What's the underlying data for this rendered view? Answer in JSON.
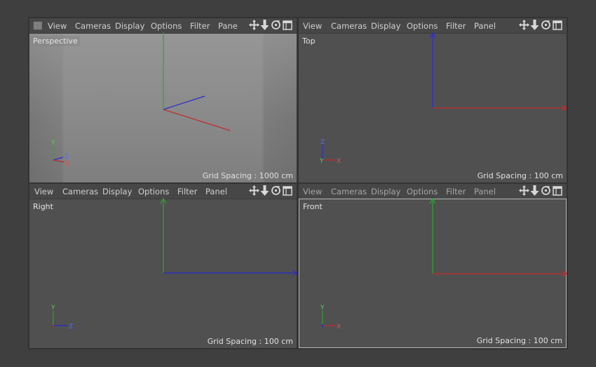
{
  "viewports": [
    {
      "id": "perspective",
      "menu": [
        "View",
        "Cameras",
        "Display",
        "Options",
        "Filter",
        "Pane"
      ],
      "label": "Perspective",
      "grid_spacing": "Grid Spacing : 1000 cm",
      "corner": {
        "y": "Y",
        "z": "Z",
        "x": "X"
      }
    },
    {
      "id": "top",
      "menu": [
        "View",
        "Cameras",
        "Display",
        "Options",
        "Filter",
        "Panel"
      ],
      "label": "Top",
      "grid_spacing": "Grid Spacing : 100 cm",
      "corner": {
        "z": "Z",
        "y": "Y",
        "x": "X"
      }
    },
    {
      "id": "right",
      "menu": [
        "View",
        "Cameras",
        "Display",
        "Options",
        "Filter",
        "Panel"
      ],
      "label": "Right",
      "grid_spacing": "Grid Spacing : 100 cm",
      "corner": {
        "y": "Y",
        "z": "Z"
      }
    },
    {
      "id": "front",
      "menu": [
        "View",
        "Cameras",
        "Display",
        "Options",
        "Filter",
        "Panel"
      ],
      "label": "Front",
      "grid_spacing": "Grid Spacing : 100 cm",
      "corner": {
        "y": "Y",
        "x": "X"
      }
    }
  ],
  "colors": {
    "x_axis": "#c22b2b",
    "y_axis": "#2fa52f",
    "z_axis": "#2b2bd0",
    "x_label": "#e05050",
    "y_label": "#50d050",
    "z_label": "#4f6fff"
  },
  "icons": [
    "move-view-icon",
    "dolly-view-icon",
    "rotate-view-icon",
    "toggle-maximize-icon"
  ],
  "active_viewport": "front"
}
